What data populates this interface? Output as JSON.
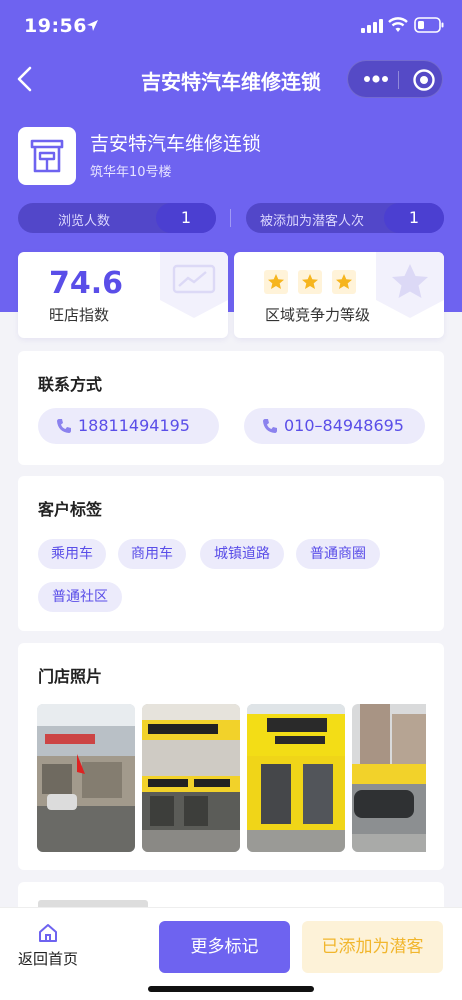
{
  "colors": {
    "brand": "#6e63f0",
    "accent_dark": "#4b3fd1",
    "tag_bg": "#ecebfb",
    "star": "#f6b51e",
    "added_text": "#f1b62d"
  },
  "status_bar": {
    "time": "19:56"
  },
  "nav": {
    "title": "吉安特汽车维修连锁"
  },
  "store": {
    "name": "吉安特汽车维修连锁",
    "address": "筑华年10号楼",
    "icon": "storefront-icon"
  },
  "stats": [
    {
      "label": "浏览人数",
      "value": "1"
    },
    {
      "label": "被添加为潜客人次",
      "value": "1"
    }
  ],
  "score_card": {
    "value": "74.6",
    "label": "旺店指数"
  },
  "rank_card": {
    "stars": 3,
    "label": "区域竞争力等级"
  },
  "contact": {
    "title": "联系方式",
    "phones": [
      "18811494195",
      "010–84948695"
    ]
  },
  "tags": {
    "title": "客户标签",
    "items": [
      "乘用车",
      "商用车",
      "城镇道路",
      "普通商圈",
      "普通社区"
    ]
  },
  "photos": {
    "title": "门店照片",
    "count": 4
  },
  "bottom": {
    "home_label": "返回首页",
    "more_label": "更多标记",
    "added_label": "已添加为潜客"
  }
}
